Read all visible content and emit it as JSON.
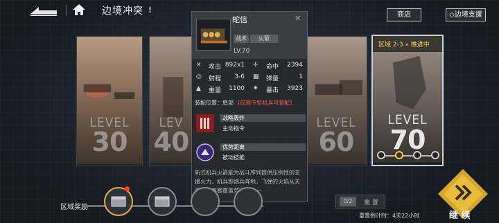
{
  "topbar": {
    "title": "边境冲突",
    "info": "!",
    "shop_label": "商店",
    "support_label": "◇边境支援"
  },
  "cards": [
    {
      "level_word": "LEVEL",
      "level_num": "30"
    },
    {
      "level_word": "LEV",
      "level_num": "40"
    },
    {
      "level_word": "LEVEL",
      "level_num": "60"
    },
    {
      "level_word": "LEVEL",
      "level_num": "70",
      "zone": "区域 2-3 » 推进中"
    }
  ],
  "popup": {
    "name": "蛇信",
    "tag1": "战术",
    "tag2": "火箭",
    "lv": "LV.70",
    "stats": [
      {
        "l1": "攻击",
        "v1": "892x1",
        "l2": "命中",
        "v2": "2394"
      },
      {
        "l1": "射程",
        "v1": "3-6",
        "l2": "弹量",
        "v2": "1"
      },
      {
        "l1": "重量",
        "v1": "1100",
        "l2": "暴击",
        "v2": "3923"
      }
    ],
    "equip_label": "装配位置：肩部",
    "equip_warn": "[仅限中型机兵可装配]",
    "skills": [
      {
        "name": "战略轰炸",
        "type": "主动指令"
      },
      {
        "name": "优势距离",
        "type": "被动技能"
      }
    ],
    "desc": "新式机兵火箭能为战斗序列提供压倒性的支援火力，机兵即炮兵阵地，飞弹的火焰从天而降，毒雾覆盖范围内的一"
  },
  "bottom": {
    "reward_label": "区域奖励",
    "reset_count": "0/2",
    "reset_label": "重 置",
    "reset_timer": "重置倒计时：4天22小时",
    "continue_label": "继 续"
  },
  "colors": {
    "accent_yellow": "#ffcc3b",
    "warn_red": "#ff5a4a"
  }
}
